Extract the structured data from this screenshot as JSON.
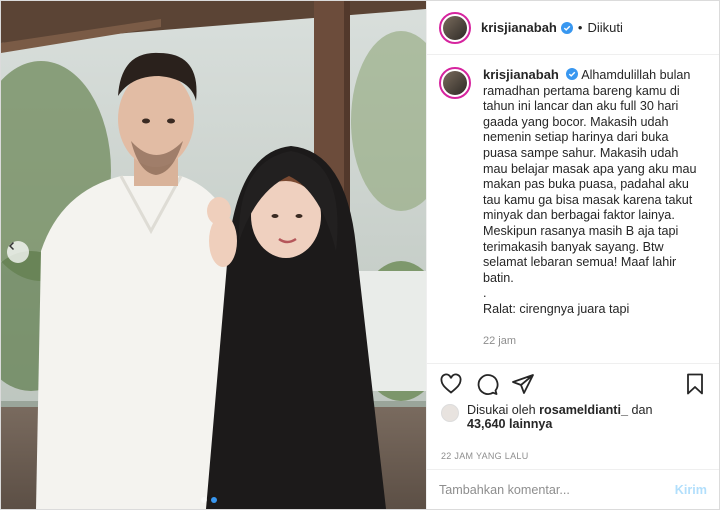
{
  "header": {
    "username": "krisjianabah",
    "separator": "•",
    "follow_status": "Diikuti"
  },
  "caption": {
    "username": "krisjianabah",
    "lines": [
      "Alhamdulillah bulan",
      "ramadhan pertama bareng kamu di",
      "tahun ini lancar dan aku full 30 hari",
      "gaada yang bocor. Makasih udah",
      "nemenin setiap harinya dari buka",
      "puasa sampe sahur. Makasih udah",
      "mau belajar masak apa yang aku mau",
      "makan pas buka puasa, padahal aku",
      "tau kamu ga bisa masak karena takut",
      "minyak dan berbagai faktor lainya.",
      "Meskipun rasanya masih B aja tapi",
      "terimakasih banyak sayang. Btw",
      "selamat lebaran semua! Maaf lahir",
      "batin.",
      ".",
      "Ralat: cirengnya juara tapi"
    ],
    "time": "22 jam"
  },
  "likes": {
    "prefix": "Disukai oleh",
    "user": "rosameldianti_",
    "conj": "dan",
    "count": "43,640",
    "suffix": "lainnya"
  },
  "posted": "22 JAM YANG LALU",
  "comment": {
    "placeholder": "Tambahkan komentar...",
    "send_label": "Kirim"
  },
  "icons": {
    "like": "heart-icon",
    "comment": "comment-icon",
    "share": "share-icon",
    "save": "bookmark-icon",
    "verified": "verified-badge-icon",
    "carousel_prev": "chevron-left-icon"
  },
  "colors": {
    "verified": "#3897f0",
    "send_disabled": "#b2dffc",
    "muted": "#8e8e8e"
  },
  "carousel": {
    "slides": 2,
    "active": 2
  }
}
